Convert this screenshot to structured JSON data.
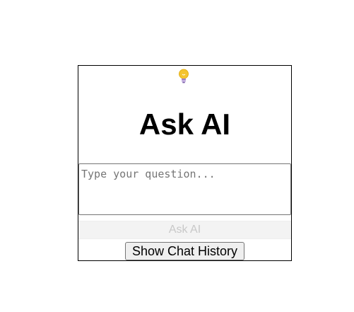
{
  "header": {
    "icon": "lightbulb-icon",
    "title": "Ask AI"
  },
  "question": {
    "value": "",
    "placeholder": "Type your question..."
  },
  "actions": {
    "ask_label": "Ask AI",
    "ask_disabled": true,
    "history_label": "Show Chat History"
  },
  "colors": {
    "bulb": "#f4c430",
    "bulb_base": "#9c7cc4",
    "disabled_text": "#c8c8c8"
  }
}
